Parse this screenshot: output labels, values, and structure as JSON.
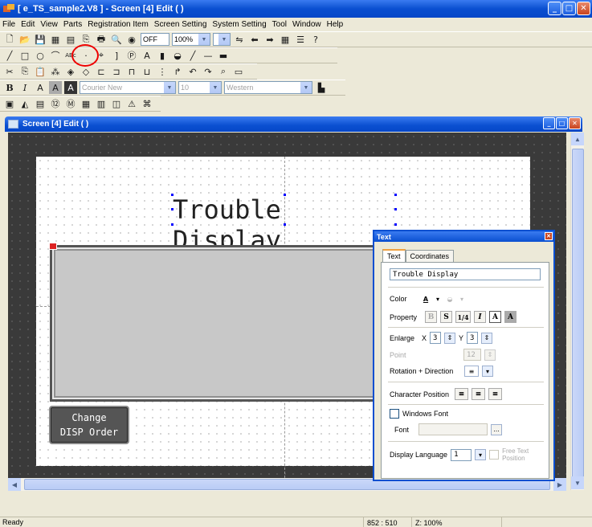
{
  "window": {
    "title": "[ e_TS_sample2.V8 ] - Screen [4] Edit (                        )"
  },
  "menu": [
    "File",
    "Edit",
    "View",
    "Parts",
    "Registration Item",
    "Screen Setting",
    "System Setting",
    "Tool",
    "Window",
    "Help"
  ],
  "toolbar": {
    "zoom": "100%",
    "off_label": "OFF",
    "font_name": "Courier New",
    "font_size": "10",
    "charset": "Western",
    "text_tool_label": "ABc"
  },
  "child_window": {
    "title": "Screen [4] Edit (                )"
  },
  "screen": {
    "title_text": "Trouble Display",
    "button_line1": "Change",
    "button_line2": "DISP Order"
  },
  "text_dialog": {
    "title": "Text",
    "tabs": [
      "Text",
      "Coordinates"
    ],
    "text_value": "Trouble Display",
    "color_label": "Color",
    "property_label": "Property",
    "enlarge_label": "Enlarge",
    "enlarge_x_label": "X",
    "enlarge_x": "3",
    "enlarge_y_label": "Y",
    "enlarge_y": "3",
    "point_label": "Point",
    "point_value": "12",
    "rotation_label": "Rotation + Direction",
    "char_position_label": "Character Position",
    "windows_font_label": "Windows Font",
    "font_label": "Font",
    "browse_label": "...",
    "display_language_label": "Display Language",
    "display_language_value": "1",
    "free_text_label": "Free Text Position"
  },
  "status": {
    "left": "Ready",
    "coords": "852 : 510",
    "zoom": "Z: 100%"
  },
  "colors": {
    "title_blue": "#0a4fd0",
    "canvas_dark": "#3a3a3a",
    "highlight_red": "#e00000"
  }
}
